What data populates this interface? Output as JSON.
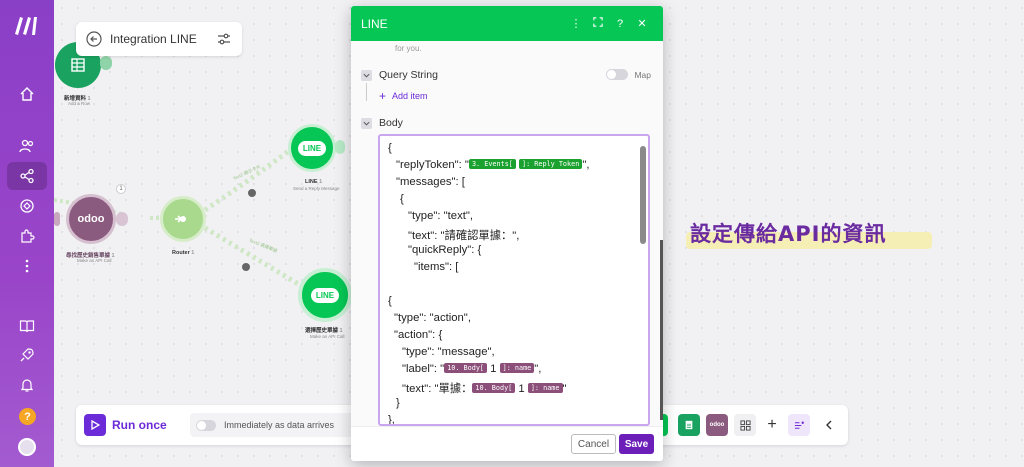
{
  "scenario": {
    "title": "Integration LINE"
  },
  "nodes": {
    "sheets": {
      "label": "新增資料",
      "badge": "1",
      "sub": "Add a Row"
    },
    "odoo": {
      "logo_text": "odoo",
      "label": "尋找歷史銷售單據",
      "badge": "1",
      "sub": "Make an API Call"
    },
    "router": {
      "label": "Router",
      "badge": "1"
    },
    "line_reply": {
      "logo_text": "LINE",
      "label": "LINE",
      "badge": "1",
      "sub": "Send a Reply Message"
    },
    "line_bottom": {
      "logo_text": "LINE",
      "label": "選擇歷史單據",
      "badge": "1",
      "sub": "Make an API Call"
    },
    "link_top_label": "Text2 顯示卡片",
    "link_bottom_label": "Text2 選擇單據"
  },
  "modal": {
    "title": "LINE",
    "cut_text": "for you.",
    "query_string_label": "Query String",
    "map_label": "Map",
    "add_item_label": "Add item",
    "body_label": "Body",
    "code": {
      "l1": "{",
      "l2a": "\"replyToken\": \"",
      "l2p1": "3. Events[",
      "l2p2": "]: Reply Token",
      "l2b": "\",",
      "l3": "\"messages\": [",
      "l4": "{",
      "l5": "\"type\": \"text\",",
      "l6": "\"text\": \"請確認單據：\",",
      "l7": "\"quickReply\": {",
      "l8": "\"items\": [",
      "l9": "{",
      "l10": "\"type\": \"action\",",
      "l11": "\"action\": {",
      "l12": "\"type\": \"message\",",
      "l13a": "\"label\": \"",
      "l13p1": "10. Body[",
      "l13mid": "1",
      "l13p2": "]: name",
      "l13b": "\",",
      "l14a": "\"text\": \"單據：",
      "l14p1": "10. Body[",
      "l14mid": "1",
      "l14p2": "]: name",
      "l14b": "\"",
      "l15": "}",
      "l16": "},",
      "l17": "{"
    },
    "cancel_label": "Cancel",
    "save_label": "Save"
  },
  "toolbar": {
    "run_once_label": "Run once",
    "immediately_label": "Immediately as data arrives"
  },
  "annotation": "設定傳給API的資訊",
  "sidebar": {
    "help_label": "?"
  },
  "colors": {
    "line_green": "#06c755",
    "brand_purple": "#6c2bd9",
    "odoo": "#8b5a7f",
    "sheets": "#1aa260"
  }
}
